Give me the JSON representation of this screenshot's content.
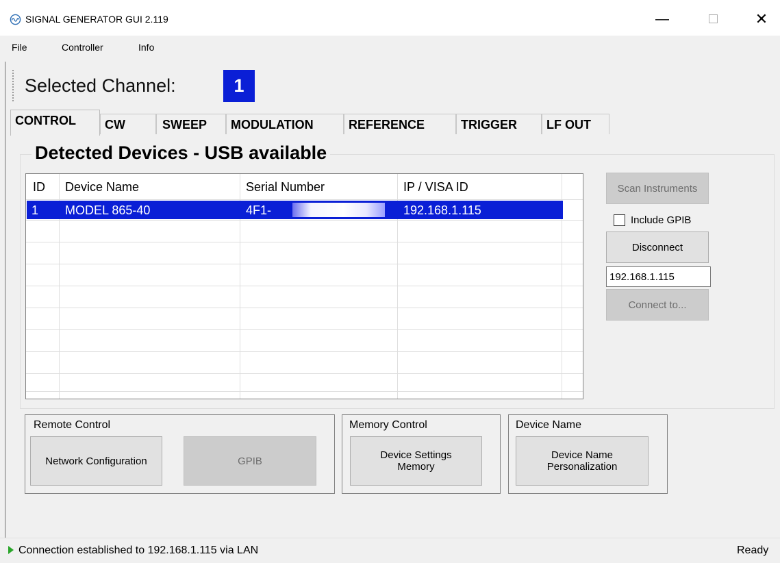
{
  "window": {
    "title": "SIGNAL GENERATOR GUI 2.119",
    "minimize": "—",
    "close": "✕"
  },
  "menu": [
    "File",
    "Controller",
    "Info"
  ],
  "channel": {
    "label": "Selected Channel:",
    "value": "1"
  },
  "tabs": [
    "CONTROL",
    "CW",
    "SWEEP",
    "MODULATION",
    "REFERENCE",
    "TRIGGER",
    "LF OUT"
  ],
  "active_tab": "CONTROL",
  "devices": {
    "title": "Detected Devices - USB available",
    "columns": [
      "ID",
      "Device Name",
      "Serial Number",
      "IP / VISA ID"
    ],
    "rows": [
      {
        "id": "1",
        "name": "MODEL 865-40",
        "serial": "4F1-",
        "ip": "192.168.1.115"
      }
    ]
  },
  "controls": {
    "scan": "Scan Instruments",
    "include_gpib": "Include  GPIB",
    "include_gpib_checked": false,
    "disconnect": "Disconnect",
    "ip_value": "192.168.1.115",
    "connect_to": "Connect to..."
  },
  "remote_control": {
    "title": "Remote Control",
    "network": "Network Configuration",
    "gpib": "GPIB"
  },
  "memory_control": {
    "title": "Memory Control",
    "settings_line1": "Device Settings",
    "settings_line2": "Memory"
  },
  "device_name": {
    "title": "Device Name",
    "line1": "Device Name",
    "line2": "Personalization"
  },
  "status": {
    "message": "Connection established to 192.168.1.115 via LAN",
    "state": "Ready"
  },
  "colors": {
    "selection": "#0a1fd6",
    "status_ok": "#2aa62a"
  }
}
